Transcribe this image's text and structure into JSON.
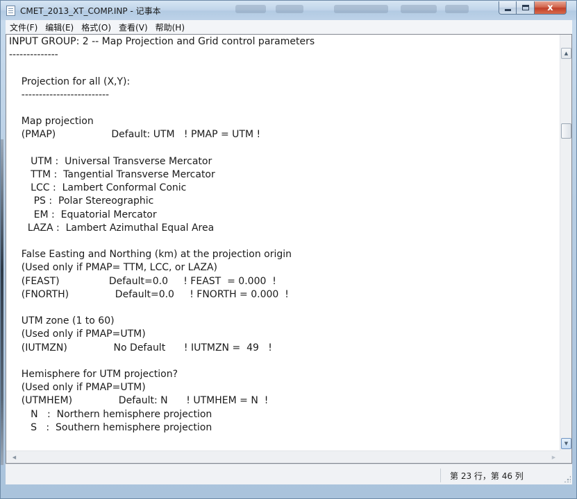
{
  "window": {
    "title": "CMET_2013_XT_COMP.INP - 记事本",
    "controls": {
      "minimize": "minimize",
      "maximize": "maximize",
      "close": "x"
    }
  },
  "menu": {
    "items": [
      {
        "label": "文件(F)"
      },
      {
        "label": "编辑(E)"
      },
      {
        "label": "格式(O)"
      },
      {
        "label": "查看(V)"
      },
      {
        "label": "帮助(H)"
      }
    ]
  },
  "editor": {
    "content": "INPUT GROUP: 2 -- Map Projection and Grid control parameters\n--------------\n\n    Projection for all (X,Y):\n    -------------------------\n\n    Map projection\n    (PMAP)                  Default: UTM   ! PMAP = UTM !\n\n       UTM :  Universal Transverse Mercator\n       TTM :  Tangential Transverse Mercator\n       LCC :  Lambert Conformal Conic\n        PS :  Polar Stereographic\n        EM :  Equatorial Mercator\n      LAZA :  Lambert Azimuthal Equal Area\n\n    False Easting and Northing (km) at the projection origin\n    (Used only if PMAP= TTM, LCC, or LAZA)\n    (FEAST)                Default=0.0     ! FEAST  = 0.000  !\n    (FNORTH)               Default=0.0     ! FNORTH = 0.000  !\n\n    UTM zone (1 to 60)\n    (Used only if PMAP=UTM)\n    (IUTMZN)               No Default      ! IUTMZN =  49   !\n\n    Hemisphere for UTM projection?\n    (Used only if PMAP=UTM)\n    (UTMHEM)               Default: N      ! UTMHEM = N  !\n       N   :  Northern hemisphere projection\n       S   :  Southern hemisphere projection\n"
  },
  "status": {
    "position": "第 23 行，第 46 列"
  },
  "icons": {
    "app": "notepad-icon",
    "scroll_up": "scroll-up-arrow-icon",
    "scroll_down": "scroll-down-arrow-icon",
    "scroll_left": "scroll-left-arrow-icon",
    "scroll_right": "scroll-right-arrow-icon",
    "grip": "resize-grip-icon"
  }
}
